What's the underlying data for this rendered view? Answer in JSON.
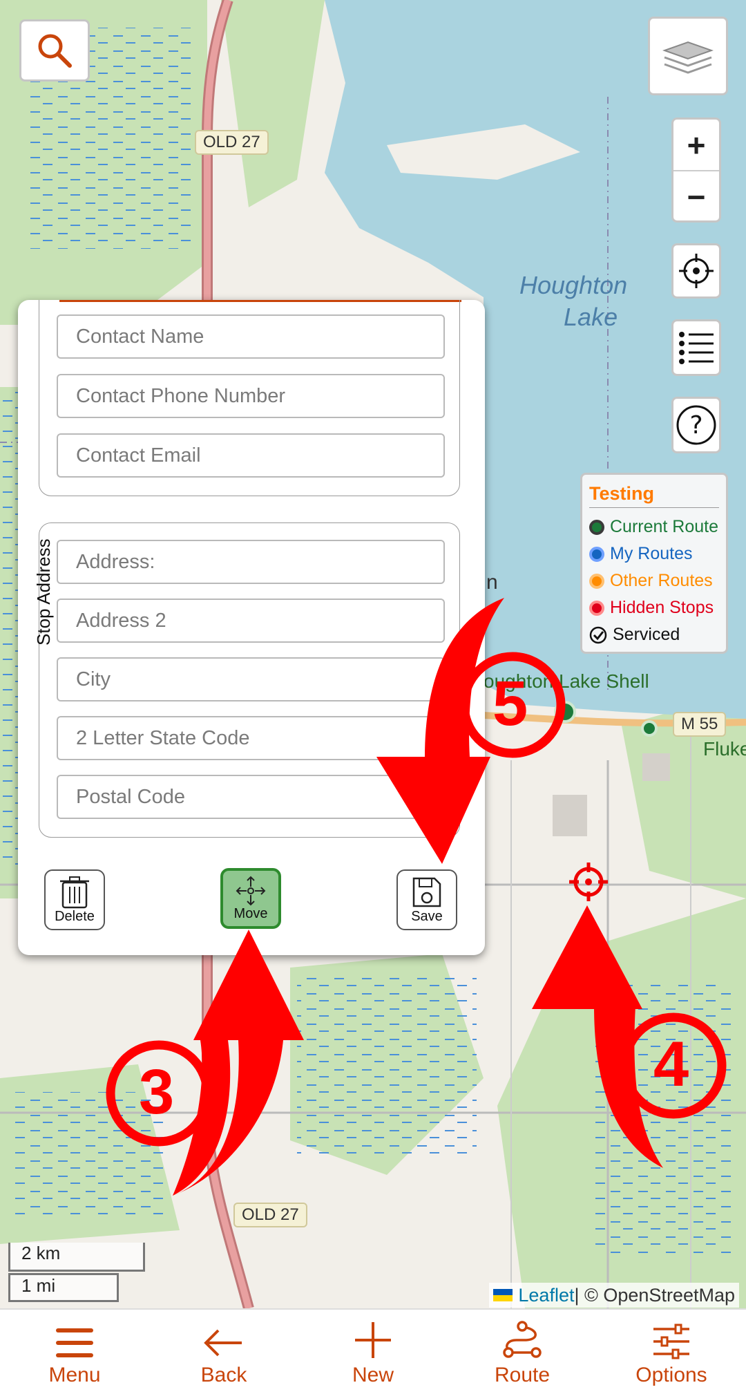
{
  "map": {
    "road_labels": [
      "OLD 27",
      "OLD 27",
      "M 55"
    ],
    "lake_label_line1": "Houghton",
    "lake_label_line2": "Lake",
    "poi_label": "oughton Lake Shell",
    "fluke_label": "Fluke",
    "n_label": "n"
  },
  "controls": {
    "search_icon": "search-icon",
    "layers_icon": "layers-icon",
    "zoom_in": "+",
    "zoom_out": "−",
    "locate_icon": "crosshair-icon",
    "list_icon": "list-icon",
    "help_icon": "question-icon"
  },
  "legend": {
    "title": "Testing",
    "items": [
      {
        "label": "Current Route",
        "color": "#1c7a3a"
      },
      {
        "label": "My Routes",
        "color": "#1565c0"
      },
      {
        "label": "Other Routes",
        "color": "#ff8c00"
      },
      {
        "label": "Hidden Stops",
        "color": "#e0001b"
      },
      {
        "label": "Serviced",
        "color": "#111111"
      }
    ]
  },
  "form": {
    "contact_name_placeholder": "Contact Name",
    "contact_phone_placeholder": "Contact Phone Number",
    "contact_email_placeholder": "Contact Email",
    "stop_address_label": "Stop Address",
    "address_placeholder": "Address:",
    "address2_placeholder": "Address 2",
    "city_placeholder": "City",
    "state_placeholder": "2 Letter State Code",
    "postal_placeholder": "Postal Code",
    "delete_label": "Delete",
    "move_label": "Move",
    "save_label": "Save"
  },
  "annotations": {
    "step3": "3",
    "step4": "4",
    "step5": "5",
    "arrow_color": "#ff0000"
  },
  "scale": {
    "km": "2 km",
    "mi": "1 mi"
  },
  "attribution": {
    "leaflet": "Leaflet",
    "rest": " | © OpenStreetMap"
  },
  "bottom_nav": [
    {
      "label": "Menu"
    },
    {
      "label": "Back"
    },
    {
      "label": "New"
    },
    {
      "label": "Route"
    },
    {
      "label": "Options"
    }
  ],
  "colors": {
    "accent": "#c9450b",
    "lake": "#aad3df",
    "forest": "#c8e2b5",
    "land": "#f2efe9"
  }
}
